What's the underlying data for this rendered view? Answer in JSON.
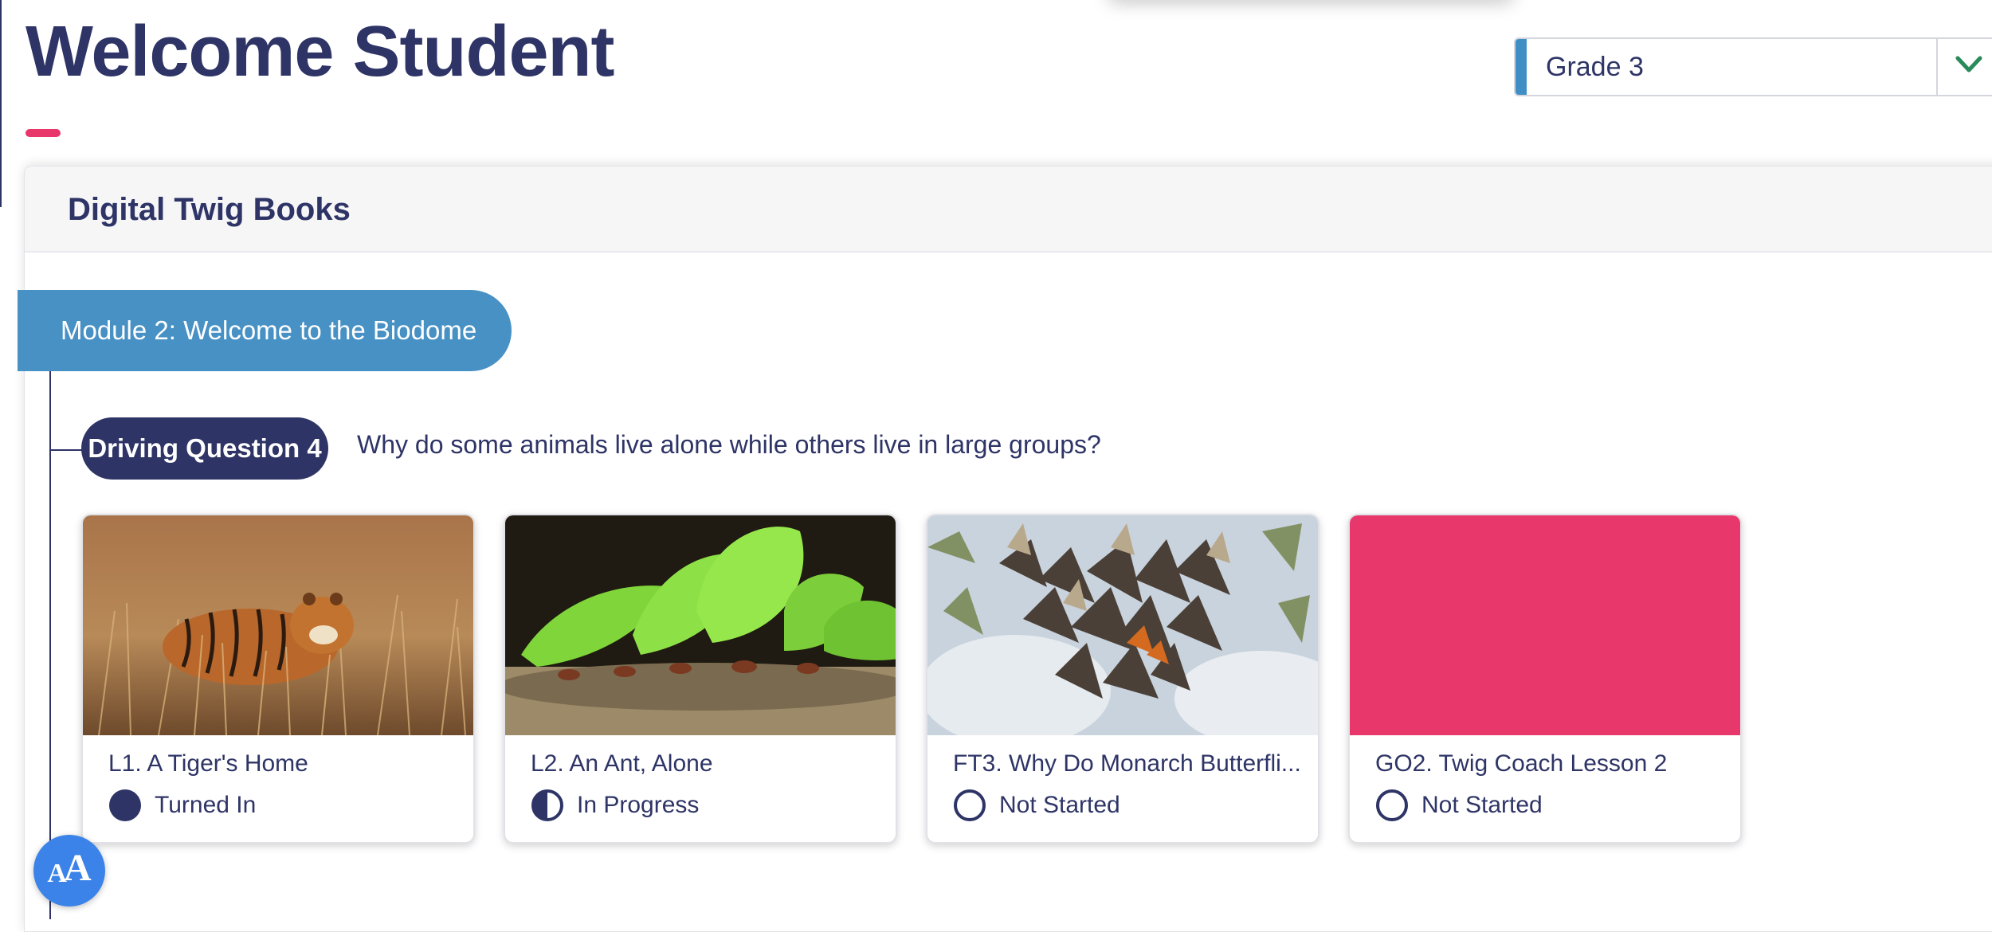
{
  "header": {
    "title": "Welcome Student"
  },
  "grade_selector": {
    "value": "Grade 3",
    "icon": "chevron-down-icon",
    "accent_color": "#3f8fc6",
    "chevron_color": "#2a8a5a"
  },
  "section": {
    "title": "Digital Twig Books"
  },
  "module": {
    "label": "Module 2: Welcome to the Biodome",
    "color": "#4891c4"
  },
  "driving_question": {
    "badge": "Driving Question 4",
    "text": "Why do some animals live alone while others live in large groups?"
  },
  "lessons": [
    {
      "title": "L1. A Tiger's Home",
      "status": "Turned In",
      "status_icon": "filled-circle-icon",
      "thumbnail": "tiger-photo"
    },
    {
      "title": "L2. An Ant, Alone",
      "status": "In Progress",
      "status_icon": "half-circle-icon",
      "thumbnail": "leafcutter-ants-photo"
    },
    {
      "title": "FT3. Why Do Monarch Butterfli...",
      "status": "Not Started",
      "status_icon": "empty-circle-icon",
      "thumbnail": "monarch-butterflies-photo"
    },
    {
      "title": "GO2. Twig Coach Lesson 2",
      "status": "Not Started",
      "status_icon": "empty-circle-icon",
      "thumbnail": "pink-placeholder"
    }
  ],
  "text_size_button": {
    "label_small": "A",
    "label_large": "A"
  },
  "colors": {
    "navy": "#2e3466",
    "pink": "#e8386b",
    "button_blue": "#3b83e8"
  }
}
